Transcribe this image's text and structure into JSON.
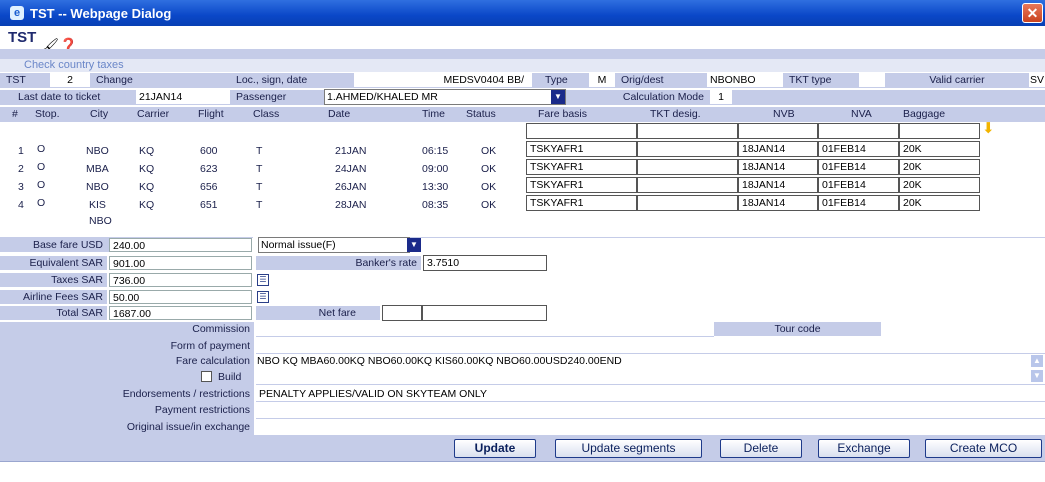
{
  "window": {
    "title": "TST -- Webpage Dialog",
    "close_glyph": "✕"
  },
  "header": {
    "logo": "TST",
    "tool_icons": "🖌❓"
  },
  "links": {
    "check_taxes": "Check country taxes"
  },
  "row1": {
    "tst_label": "TST",
    "tst_value": "2",
    "change_label": "Change",
    "loc_label": "Loc., sign, date",
    "loc_value": "MEDSV0404 BB/",
    "type_label": "Type",
    "type_value": "M",
    "orig_label": "Orig/dest",
    "orig_value": "NBONBO",
    "tkt_type_label": "TKT type",
    "tkt_type_value": "",
    "carrier_label": "Valid carrier",
    "carrier_value": "SV"
  },
  "row2": {
    "last_date_label": "Last date to ticket",
    "last_date_value": "21JAN14",
    "passenger_label": "Passenger",
    "passenger_value": "1.AHMED/KHALED MR",
    "calc_label": "Calculation Mode",
    "calc_value": "1"
  },
  "columns": {
    "num": "#",
    "stop": "Stop.",
    "city": "City",
    "carrier": "Carrier",
    "flight": "Flight",
    "class": "Class",
    "date": "Date",
    "time": "Time",
    "status": "Status",
    "fare_basis": "Fare basis",
    "tkt_desig": "TKT desig.",
    "nvb": "NVB",
    "nva": "NVA",
    "baggage": "Baggage"
  },
  "segments": [
    {
      "num": "1",
      "stop": "O",
      "city": "NBO",
      "carrier": "KQ",
      "flight": "600",
      "class": "T",
      "date": "21JAN",
      "time": "06:15",
      "status": "OK",
      "fare_basis": "TSKYAFR1",
      "tkt_desig": "",
      "nvb": "18JAN14",
      "nva": "01FEB14",
      "baggage": "20K"
    },
    {
      "num": "2",
      "stop": "O",
      "city": "MBA",
      "carrier": "KQ",
      "flight": "623",
      "class": "T",
      "date": "24JAN",
      "time": "09:00",
      "status": "OK",
      "fare_basis": "TSKYAFR1",
      "tkt_desig": "",
      "nvb": "18JAN14",
      "nva": "01FEB14",
      "baggage": "20K"
    },
    {
      "num": "3",
      "stop": "O",
      "city": "NBO",
      "carrier": "KQ",
      "flight": "656",
      "class": "T",
      "date": "26JAN",
      "time": "13:30",
      "status": "OK",
      "fare_basis": "TSKYAFR1",
      "tkt_desig": "",
      "nvb": "18JAN14",
      "nva": "01FEB14",
      "baggage": "20K"
    },
    {
      "num": "4",
      "stop": "O",
      "city": "KIS",
      "carrier": "KQ",
      "flight": "651",
      "class": "T",
      "date": "28JAN",
      "time": "08:35",
      "status": "OK",
      "fare_basis": "TSKYAFR1",
      "tkt_desig": "",
      "nvb": "18JAN14",
      "nva": "01FEB14",
      "baggage": "20K"
    }
  ],
  "final_city": "NBO",
  "fares": {
    "base_label": "Base fare USD",
    "base_value": "240.00",
    "issue_value": "Normal issue(F)",
    "equiv_label": "Equivalent SAR",
    "equiv_value": "901.00",
    "bankers_label": "Banker's rate",
    "bankers_value": "3.7510",
    "taxes_label": "Taxes SAR",
    "taxes_value": "736.00",
    "airline_label": "Airline Fees SAR",
    "airline_value": "50.00",
    "total_label": "Total SAR",
    "total_value": "1687.00",
    "net_label": "Net fare",
    "net_value": ""
  },
  "details": {
    "commission_label": "Commission",
    "commission_value": "",
    "tour_code_label": "Tour code",
    "tour_code_value": "",
    "fop_label": "Form of payment",
    "fop_value": "",
    "fare_calc_label": "Fare calculation",
    "fare_calc_value": "NBO KQ MBA60.00KQ NBO60.00KQ KIS60.00KQ NBO60.00USD240.00END",
    "build_label": "Build",
    "endorse_label": "Endorsements / restrictions",
    "endorse_value": "PENALTY APPLIES/VALID ON SKYTEAM ONLY",
    "payment_restr_label": "Payment restrictions",
    "payment_restr_value": "",
    "orig_issue_label": "Original issue/in exchange",
    "orig_issue_value": ""
  },
  "buttons": {
    "update": "Update",
    "update_segments": "Update segments",
    "delete": "Delete",
    "exchange": "Exchange",
    "create_mco": "Create MCO"
  }
}
